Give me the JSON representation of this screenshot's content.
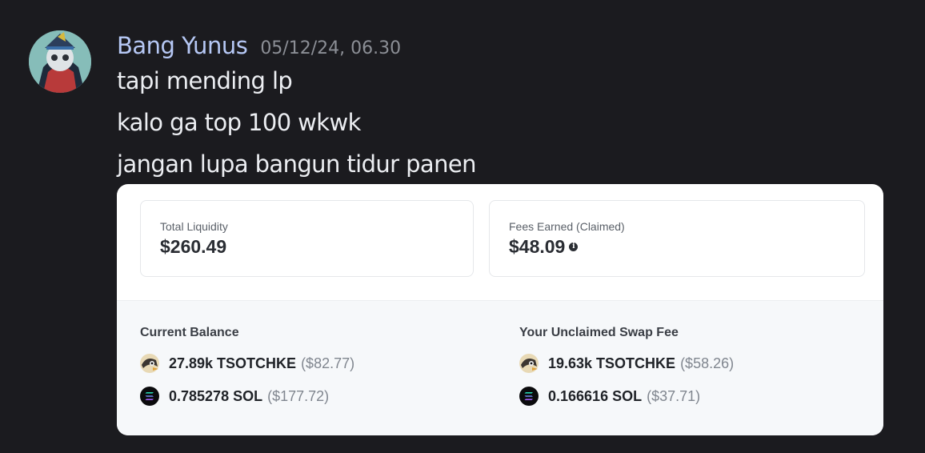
{
  "message": {
    "username": "Bang Yunus",
    "timestamp": "05/12/24, 06.30",
    "lines": [
      "tapi mending lp",
      "kalo ga top 100 wkwk",
      "jangan lupa bangun tidur panen"
    ]
  },
  "card": {
    "stats": [
      {
        "label": "Total Liquidity",
        "value": "$260.49"
      },
      {
        "label": "Fees Earned (Claimed)",
        "value": "$48.09",
        "icon": "info-icon"
      }
    ],
    "current_balance": {
      "title": "Current Balance",
      "items": [
        {
          "icon": "tsotchke-token-icon",
          "amount": "27.89k TSOTCHKE",
          "usd": "($82.77)"
        },
        {
          "icon": "solana-token-icon",
          "amount": "0.785278 SOL",
          "usd": "($177.72)"
        }
      ]
    },
    "unclaimed_fee": {
      "title": "Your Unclaimed Swap Fee",
      "items": [
        {
          "icon": "tsotchke-token-icon",
          "amount": "19.63k TSOTCHKE",
          "usd": "($58.26)"
        },
        {
          "icon": "solana-token-icon",
          "amount": "0.166616 SOL",
          "usd": "($37.71)"
        }
      ]
    }
  },
  "colors": {
    "background": "#1b1b1f",
    "username": "#b6c8f5",
    "timestamp": "#8c8f96",
    "message_text": "#eceef2"
  }
}
